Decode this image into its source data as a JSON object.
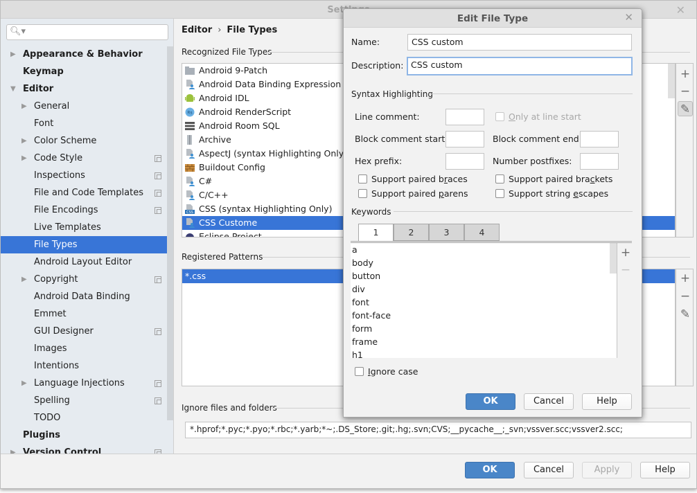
{
  "window": {
    "title": "Settings"
  },
  "sidebar": {
    "search_placeholder": "",
    "items": [
      {
        "label": "Appearance & Behavior",
        "level": 0,
        "arrow": "right",
        "project": false
      },
      {
        "label": "Keymap",
        "level": 0,
        "arrow": "",
        "project": false
      },
      {
        "label": "Editor",
        "level": 0,
        "arrow": "down",
        "project": false
      },
      {
        "label": "General",
        "level": 1,
        "arrow": "right",
        "project": false
      },
      {
        "label": "Font",
        "level": 1,
        "arrow": "",
        "project": false
      },
      {
        "label": "Color Scheme",
        "level": 1,
        "arrow": "right",
        "project": false
      },
      {
        "label": "Code Style",
        "level": 1,
        "arrow": "right",
        "project": true
      },
      {
        "label": "Inspections",
        "level": 1,
        "arrow": "",
        "project": true
      },
      {
        "label": "File and Code Templates",
        "level": 1,
        "arrow": "",
        "project": true
      },
      {
        "label": "File Encodings",
        "level": 1,
        "arrow": "",
        "project": true
      },
      {
        "label": "Live Templates",
        "level": 1,
        "arrow": "",
        "project": false
      },
      {
        "label": "File Types",
        "level": 1,
        "arrow": "",
        "project": false,
        "selected": true
      },
      {
        "label": "Android Layout Editor",
        "level": 1,
        "arrow": "",
        "project": false
      },
      {
        "label": "Copyright",
        "level": 1,
        "arrow": "right",
        "project": true
      },
      {
        "label": "Android Data Binding",
        "level": 1,
        "arrow": "",
        "project": false
      },
      {
        "label": "Emmet",
        "level": 1,
        "arrow": "",
        "project": false
      },
      {
        "label": "GUI Designer",
        "level": 1,
        "arrow": "",
        "project": true
      },
      {
        "label": "Images",
        "level": 1,
        "arrow": "",
        "project": false
      },
      {
        "label": "Intentions",
        "level": 1,
        "arrow": "",
        "project": false
      },
      {
        "label": "Language Injections",
        "level": 1,
        "arrow": "right",
        "project": true
      },
      {
        "label": "Spelling",
        "level": 1,
        "arrow": "",
        "project": true
      },
      {
        "label": "TODO",
        "level": 1,
        "arrow": "",
        "project": false
      },
      {
        "label": "Plugins",
        "level": 0,
        "arrow": "",
        "project": false
      },
      {
        "label": "Version Control",
        "level": 0,
        "arrow": "right",
        "project": true
      }
    ]
  },
  "content": {
    "breadcrumb": {
      "parent": "Editor",
      "separator": "›",
      "current": "File Types"
    },
    "recognized_title": "Recognized File Types",
    "file_types": [
      {
        "label": "Android 9-Patch",
        "icon": "folder-icon"
      },
      {
        "label": "Android Data Binding Expression",
        "icon": "custom-file-icon"
      },
      {
        "label": "Android IDL",
        "icon": "android-icon"
      },
      {
        "label": "Android RenderScript",
        "icon": "renderscript-icon"
      },
      {
        "label": "Android Room SQL",
        "icon": "database-icon"
      },
      {
        "label": "Archive",
        "icon": "archive-icon"
      },
      {
        "label": "AspectJ (syntax Highlighting Only)",
        "icon": "custom-file-icon"
      },
      {
        "label": "Buildout Config",
        "icon": "bricks-icon"
      },
      {
        "label": "C#",
        "icon": "custom-file-icon"
      },
      {
        "label": "C/C++",
        "icon": "custom-file-icon"
      },
      {
        "label": "CSS (syntax Highlighting Only)",
        "icon": "css-file-icon"
      },
      {
        "label": "CSS Custome",
        "icon": "custom-file-icon",
        "selected": true
      },
      {
        "label": "Eclipse Project",
        "icon": "eclipse-icon"
      }
    ],
    "patterns_title": "Registered Patterns",
    "patterns": [
      {
        "label": "*.css",
        "selected": true
      }
    ],
    "ignore_title": "Ignore files and folders",
    "ignore_value": "*.hprof;*.pyc;*.pyo;*.rbc;*.yarb;*~;.DS_Store;.git;.hg;.svn;CVS;__pycache__;_svn;vssver.scc;vssver2.scc;"
  },
  "footer": {
    "ok": "OK",
    "cancel": "Cancel",
    "apply": "Apply",
    "help": "Help"
  },
  "dialog": {
    "title": "Edit File Type",
    "name_label": "Name:",
    "name_value": "CSS custom",
    "description_label": "Description:",
    "description_value": "CSS custom",
    "syntax_title": "Syntax Highlighting",
    "line_comment_label": "Line comment:",
    "line_comment_value": "",
    "only_line_start": {
      "pre": "",
      "u": "O",
      "post": "nly at line start",
      "checked": false,
      "enabled": false
    },
    "block_start_label": "Block comment start:",
    "block_start_value": "",
    "block_end_label": "Block comment end:",
    "block_end_value": "",
    "hex_prefix_label": "Hex prefix:",
    "hex_prefix_value": "",
    "number_postfixes_label": "Number postfixes:",
    "number_postfixes_value": "",
    "checkboxes": [
      {
        "pre": "Support paired b",
        "u": "r",
        "post": "aces",
        "checked": false
      },
      {
        "pre": "Support paired bra",
        "u": "c",
        "post": "kets",
        "checked": false
      },
      {
        "pre": "Support paired ",
        "u": "p",
        "post": "arens",
        "checked": false
      },
      {
        "pre": "Support string ",
        "u": "e",
        "post": "scapes",
        "checked": false
      }
    ],
    "keywords_title": "Keywords",
    "tabs": [
      "1",
      "2",
      "3",
      "4"
    ],
    "active_tab": 0,
    "keywords": [
      "a",
      "body",
      "button",
      "div",
      "font",
      "font-face",
      "form",
      "frame",
      "h1"
    ],
    "ignore_case": {
      "pre": "",
      "u": "I",
      "post": "gnore case",
      "checked": false
    },
    "ok": "OK",
    "cancel": "Cancel",
    "help": "Help"
  }
}
